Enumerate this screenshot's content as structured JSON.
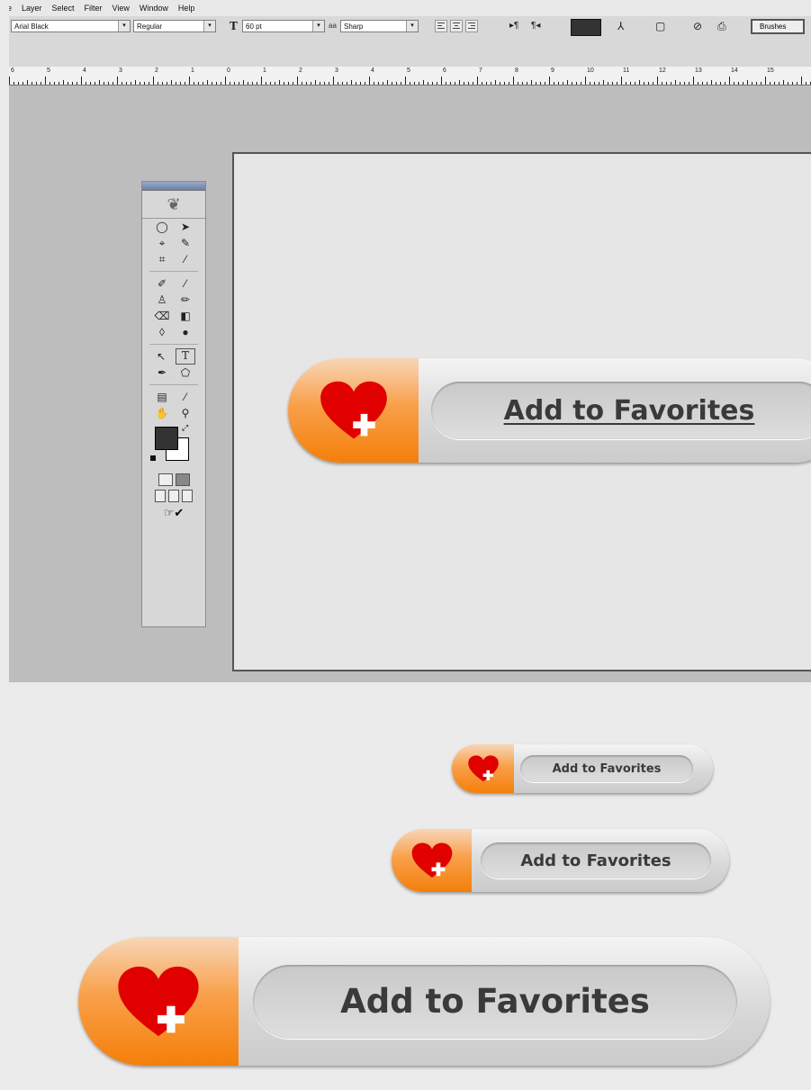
{
  "menu": [
    "ge",
    "Layer",
    "Select",
    "Filter",
    "View",
    "Window",
    "Help"
  ],
  "options_bar": {
    "font_family": "Arial Black",
    "font_style": "Regular",
    "font_size": "60 pt",
    "antialias_icon": "aa",
    "antialias": "Sharp",
    "text_color": "#333333",
    "brushes_label": "Brushes"
  },
  "ruler": {
    "labels": [
      "6",
      "5",
      "4",
      "3",
      "2",
      "1",
      "0",
      "1",
      "2",
      "3",
      "4",
      "5",
      "6",
      "7",
      "8",
      "9",
      "10",
      "11",
      "12",
      "13",
      "14",
      "15"
    ]
  },
  "canvas_button": {
    "label": "Add to Favorites"
  },
  "previews": [
    {
      "label": "Add to Favorites"
    },
    {
      "label": "Add to Favorites"
    },
    {
      "label": "Add to Favorites"
    }
  ],
  "colors": {
    "accent_orange": "#f47f0a",
    "heart_red": "#e00000",
    "foreground_color": "#333333",
    "background_color": "#ffffff"
  }
}
